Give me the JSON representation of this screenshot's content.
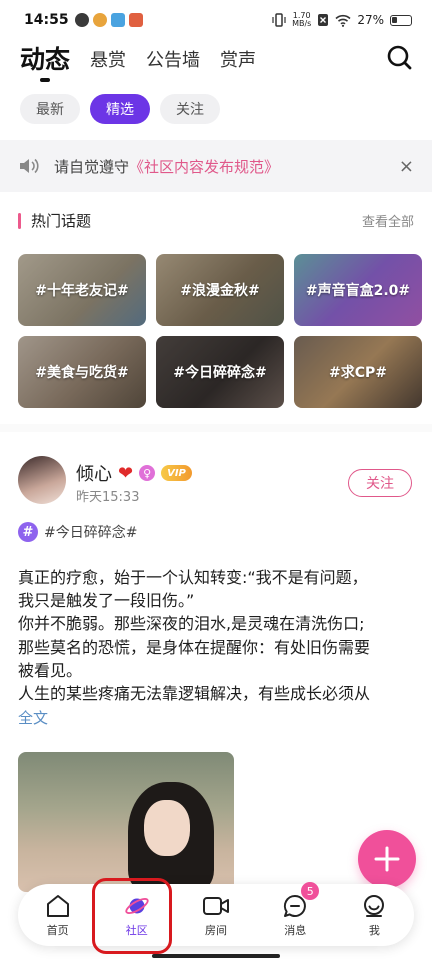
{
  "status_bar": {
    "time": "14:55",
    "net_speed_value": "1.70",
    "net_speed_unit": "MB/s",
    "battery": "27%"
  },
  "top_tabs": [
    {
      "label": "动态",
      "active": true
    },
    {
      "label": "悬赏",
      "active": false
    },
    {
      "label": "公告墙",
      "active": false
    },
    {
      "label": "赏声",
      "active": false
    }
  ],
  "filter_chips": [
    {
      "label": "最新",
      "active": false
    },
    {
      "label": "精选",
      "active": true
    },
    {
      "label": "关注",
      "active": false
    }
  ],
  "notice": {
    "text": "请自觉遵守",
    "link": "《社区内容发布规范》",
    "close": "×"
  },
  "hot_topics": {
    "title": "热门话题",
    "view_all": "查看全部",
    "items": [
      {
        "label": "#十年老友记#",
        "color": "#b8b0a0"
      },
      {
        "label": "#浪漫金秋#",
        "color": "#9a8f7e"
      },
      {
        "label": "#声音盲盒2.0#",
        "color": "#8a6cc4"
      },
      {
        "label": "#美食与吃货#",
        "color": "#a89c8c"
      },
      {
        "label": "#今日碎碎念#",
        "color": "#4a4240"
      },
      {
        "label": "#求CP#",
        "color": "#7a6b60"
      }
    ]
  },
  "post": {
    "author": "倾心",
    "heart": "❤",
    "gender_symbol": "♀",
    "vip": "VIP",
    "time": "昨天15:33",
    "follow": "关注",
    "tag": "#今日碎碎念#",
    "tag_icon": "#",
    "body_lines": [
      "真正的疗愈，始于一个认知转变:“我不是有问题，",
      "我只是触发了一段旧伤。”",
      "你并不脆弱。那些深夜的泪水,是灵魂在清洗伤口;",
      "那些莫名的恐慌，是身体在提醒你：有处旧伤需要",
      "被看见。",
      "人生的某些疼痛无法靠逻辑解决，有些成长必须从"
    ],
    "full_text": "全文"
  },
  "bottom_nav": [
    {
      "label": "首页",
      "icon": "home-icon",
      "active": false
    },
    {
      "label": "社区",
      "icon": "planet-icon",
      "active": true
    },
    {
      "label": "房间",
      "icon": "video-camera-icon",
      "active": false
    },
    {
      "label": "消息",
      "icon": "chat-bubble-icon",
      "active": false,
      "badge": "5"
    },
    {
      "label": "我",
      "icon": "smile-icon",
      "active": false
    }
  ],
  "colors": {
    "accent_purple": "#6c35e6",
    "accent_pink": "#f0509a",
    "link_pink": "#e0588a",
    "highlight_red": "#d8191e"
  }
}
